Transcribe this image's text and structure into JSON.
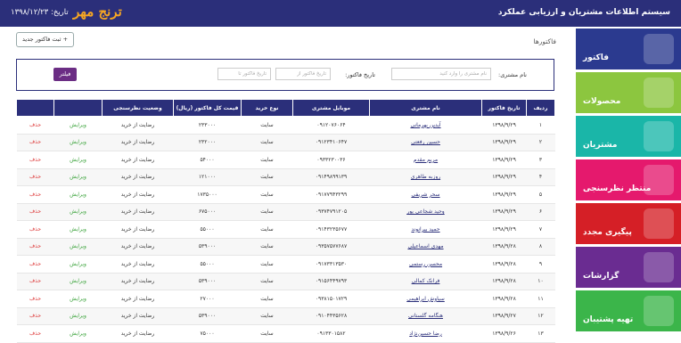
{
  "header": {
    "title": "سیستم اطلاعات مشتریان و ارزیابی عملکرد",
    "logo": "ترنج مهر",
    "date": "تاریخ: ۱۳۹۸/۱۲/۲۳"
  },
  "sidebar": {
    "items": [
      {
        "label": "فاکتور",
        "color": "#2b3a8f"
      },
      {
        "label": "محصولات",
        "color": "#8cc63f"
      },
      {
        "label": "مشتریان",
        "color": "#1ab6a8"
      },
      {
        "label": "منتظر نظرسنجی",
        "color": "#e5196d"
      },
      {
        "label": "پیگیری مجدد",
        "color": "#d51f26"
      },
      {
        "label": "گزارشات",
        "color": "#6a2c91"
      },
      {
        "label": "تهیه پشتیبان",
        "color": "#3bb54a"
      }
    ]
  },
  "toolbar": {
    "new_invoice": "+ ثبت فاکتور جدید",
    "section_title": "فاکتورها"
  },
  "filter": {
    "customer_label": "نام مشتری:",
    "customer_placeholder": "نام مشتری را وارد کنید",
    "date_label": "تاریخ فاکتور:",
    "date_from_placeholder": "تاریخ فاکتور از",
    "date_to_placeholder": "تاریخ فاکتور تا",
    "button": "فیلتر"
  },
  "table": {
    "headers": [
      "ردیف",
      "تاریخ فاکتور",
      "نام مشتری",
      "موبایل مشتری",
      "نوع خرید",
      "قیمت کل فاکتور (ریال)",
      "وضعیت نظرسنجی",
      "",
      ""
    ],
    "rows": [
      [
        "۱",
        "۱۳۹۸/۹/۲۹",
        "آیدین بهرمانی",
        "۰۹۱۲۰۷۶۰۶۴",
        "سایت",
        "۲۳۳۰۰۰",
        "رضایت از خرید",
        "ویرایش",
        "حذف"
      ],
      [
        "۲",
        "۱۳۹۸/۹/۲۹",
        "حسین رفعتی",
        "۰۹۱۲۳۴۱۰۶۴۷",
        "سایت",
        "۲۳۲۰۰۰",
        "رضایت از خرید",
        "ویرایش",
        "حذف"
      ],
      [
        "۳",
        "۱۳۹۸/۹/۲۹",
        "مریم مقدم",
        "۰۹۳۳۲۳۰۰۳۶",
        "سایت",
        "۵۴۰۰۰",
        "رضایت از خرید",
        "ویرایش",
        "حذف"
      ],
      [
        "۴",
        "۱۳۹۸/۹/۲۹",
        "روزبه طاهری",
        "۰۹۱۴۹۸۹۹۱۳۹",
        "سایت",
        "۱۲۱۰۰۰",
        "رضایت از خرید",
        "ویرایش",
        "حذف"
      ],
      [
        "۵",
        "۱۳۹۸/۹/۲۹",
        "سحر شریفی",
        "۰۹۱۷۷۹۴۳۲۹۹",
        "سایت",
        "۱۷۳۵۰۰۰",
        "رضایت از خرید",
        "ویرایش",
        "حذف"
      ],
      [
        "۶",
        "۱۳۹۸/۹/۲۹",
        "وحید شجاعی پور",
        "۰۹۳۷۴۷۹۱۲۰۵",
        "سایت",
        "۶۷۵۰۰۰",
        "رضایت از خرید",
        "ویرایش",
        "حذف"
      ],
      [
        "۷",
        "۱۳۹۸/۹/۲۹",
        "حمید بیرانوند",
        "۰۹۱۴۳۲۳۵۶۷۷",
        "سایت",
        "۵۵۰۰۰",
        "رضایت از خرید",
        "ویرایش",
        "حذف"
      ],
      [
        "۸",
        "۱۳۹۸/۹/۲۸",
        "مهدی اسماعیلی",
        "۰۹۳۵۷۵۷۷۶۸۷",
        "سایت",
        "۵۳۹۰۰۰",
        "رضایت از خرید",
        "ویرایش",
        "حذف"
      ],
      [
        "۹",
        "۱۳۹۸/۹/۲۸",
        "محسن رستمی",
        "۰۹۱۷۳۳۱۳۵۳۰",
        "سایت",
        "۵۵۰۰۰",
        "رضایت از خرید",
        "ویرایش",
        "حذف"
      ],
      [
        "۱۰",
        "۱۳۹۸/۹/۲۸",
        "فرانک کمالی",
        "۰۹۱۵۶۴۴۹۷۹۳",
        "سایت",
        "۵۳۹۰۰۰",
        "رضایت از خرید",
        "ویرایش",
        "حذف"
      ],
      [
        "۱۱",
        "۱۳۹۸/۹/۲۸",
        "سیاوش ابراهیمی",
        "۰۹۳۸۱۵۰۱۷۲۹",
        "سایت",
        "۲۷۰۰۰",
        "رضایت از خرید",
        "ویرایش",
        "حذف"
      ],
      [
        "۱۲",
        "۱۳۹۸/۹/۲۷",
        "هنگامه گلستانی",
        "۰۹۱۰۴۴۳۵۶۲۸",
        "سایت",
        "۵۳۹۰۰۰",
        "رضایت از خرید",
        "ویرایش",
        "حذف"
      ],
      [
        "۱۳",
        "۱۳۹۸/۹/۲۶",
        "رضا حسین‌نژاد",
        "۰۹۱۳۳۰۱۵۸۲",
        "سایت",
        "۷۵۰۰۰",
        "رضایت از خرید",
        "ویرایش",
        "حذف"
      ]
    ]
  }
}
